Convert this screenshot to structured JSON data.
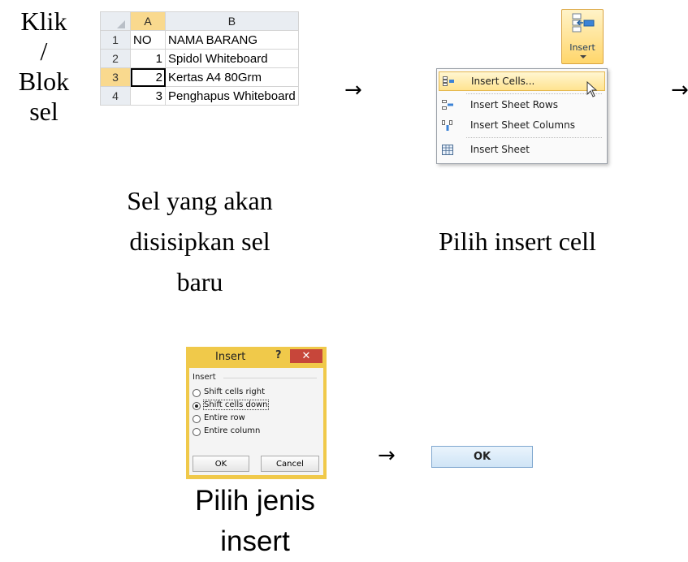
{
  "left_caption": [
    "Klik",
    "/",
    "Blok",
    "sel"
  ],
  "spreadsheet": {
    "columns": [
      "A",
      "B"
    ],
    "rows": [
      {
        "row": "1",
        "a": "NO",
        "b": "NAMA BARANG"
      },
      {
        "row": "2",
        "a": "1",
        "b": "Spidol Whiteboard"
      },
      {
        "row": "3",
        "a": "2",
        "b": "Kertas A4 80Grm"
      },
      {
        "row": "4",
        "a": "3",
        "b": "Penghapus Whiteboard"
      }
    ],
    "selected_cell": "A3",
    "selection_color": "#f9d98e"
  },
  "arrow_glyph": "→",
  "ribbon": {
    "button_label": "Insert",
    "icon": "insert-cells-icon"
  },
  "insert_menu": {
    "items": [
      {
        "label": "Insert Cells...",
        "icon": "insert-cells-icon",
        "highlighted": true
      },
      {
        "label": "Insert Sheet Rows",
        "icon": "insert-rows-icon"
      },
      {
        "label": "Insert Sheet Columns",
        "icon": "insert-columns-icon"
      },
      {
        "label": "Insert Sheet",
        "icon": "insert-sheet-icon"
      }
    ]
  },
  "captions": {
    "cell_caption": [
      "Sel yang akan",
      "disisipkan sel",
      "baru"
    ],
    "menu_caption": "Pilih insert cell",
    "dialog_caption": [
      "Pilih jenis",
      "insert"
    ]
  },
  "insert_dialog": {
    "title": "Insert",
    "help": "?",
    "close": "✕",
    "group_label": "Insert",
    "options": [
      {
        "label": "Shift cells right",
        "selected": false
      },
      {
        "label": "Shift cells down",
        "selected": true
      },
      {
        "label": "Entire row",
        "selected": false
      },
      {
        "label": "Entire column",
        "selected": false
      }
    ],
    "ok_label": "OK",
    "cancel_label": "Cancel"
  },
  "ok_button": {
    "label": "OK"
  }
}
